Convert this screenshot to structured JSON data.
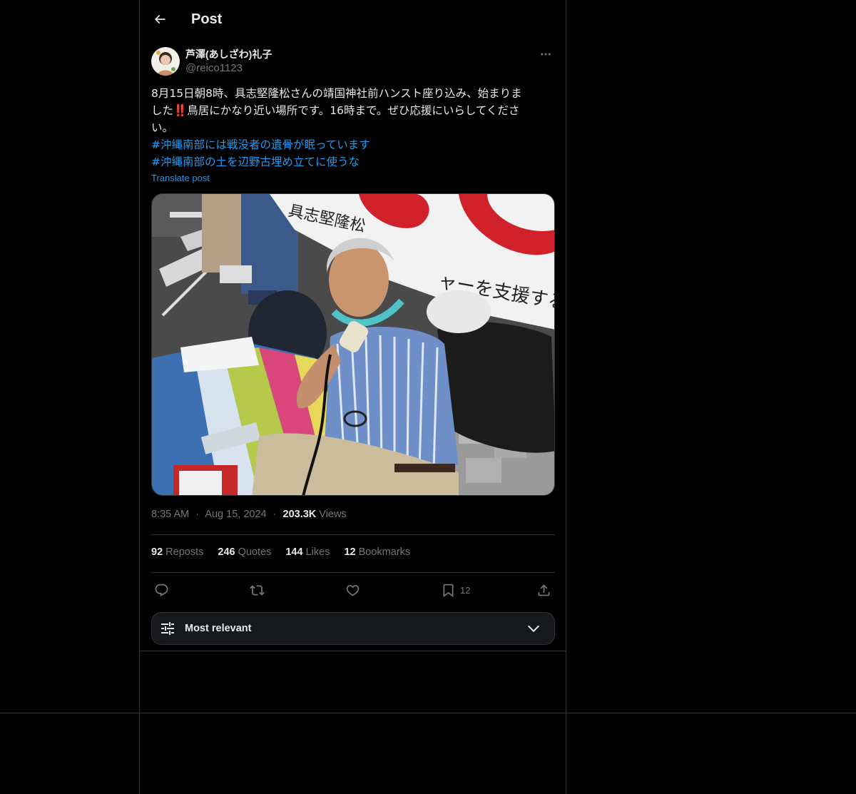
{
  "header": {
    "title": "Post",
    "back_icon": "arrow-left-icon"
  },
  "author": {
    "display_name": "芦澤(あしざわ)礼子",
    "handle": "@reico1123",
    "more_icon": "more-horizontal-icon"
  },
  "post": {
    "text_lines": [
      "8月15日朝8時、具志堅隆松さんの靖国神社前ハンスト座り込み、始まりま",
      "した‼️鳥居にかなり近い場所です。16時まで。ぜひ応援にいらしてくださ",
      "い。"
    ],
    "hashtags": [
      "#沖縄南部には戦没者の遺骨が眠っています",
      "#沖縄南部の土を辺野古埋め立てに使うな"
    ],
    "translate_label": "Translate post",
    "image_banner_text": "具志堅隆松",
    "image_banner_text_2": "ャーを支援する"
  },
  "meta": {
    "time": "8:35 AM",
    "separator": "·",
    "date": "Aug 15, 2024",
    "views_count": "203.3K",
    "views_label": "Views"
  },
  "stats": {
    "reposts_count": "92",
    "reposts_label": "Reposts",
    "quotes_count": "246",
    "quotes_label": "Quotes",
    "likes_count": "144",
    "likes_label": "Likes",
    "bookmarks_count": "12",
    "bookmarks_label": "Bookmarks"
  },
  "actions": {
    "reply_icon": "reply-icon",
    "repost_icon": "repost-icon",
    "like_icon": "heart-icon",
    "bookmark_icon": "bookmark-icon",
    "bookmark_count": "12",
    "share_icon": "share-icon"
  },
  "sort": {
    "label": "Most relevant",
    "icon": "filter-sliders-icon",
    "chevron": "chevron-down-icon"
  },
  "colors": {
    "background": "#000000",
    "text": "#e7e9ea",
    "muted": "#71767b",
    "link": "#1d9bf0",
    "border": "#2f3336"
  }
}
